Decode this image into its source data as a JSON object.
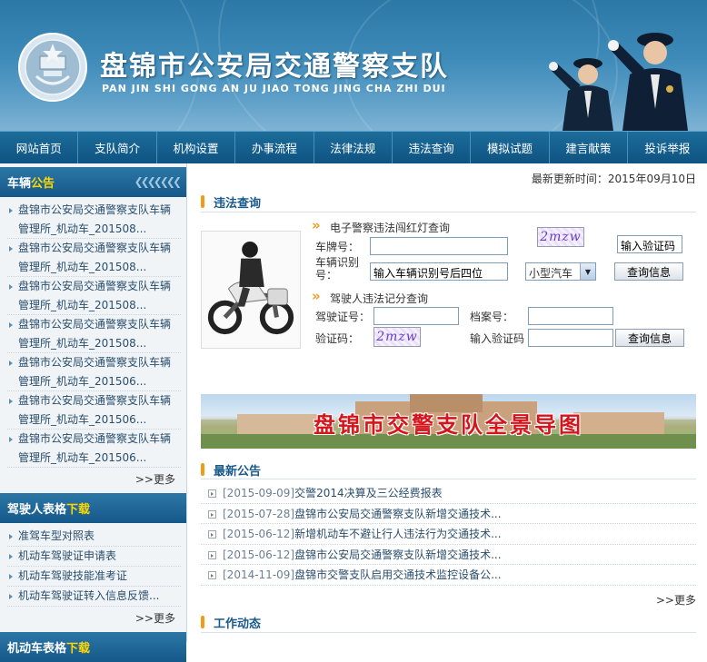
{
  "header": {
    "title": "盘锦市公安局交通警察支队",
    "subtitle": "PAN JIN SHI GONG AN JU JIAO TONG JING CHA ZHI DUI"
  },
  "nav": [
    "网站首页",
    "支队简介",
    "机构设置",
    "办事流程",
    "法律法规",
    "违法查询",
    "模拟试题",
    "建言献策",
    "投诉举报"
  ],
  "sidebar": {
    "vehicle_notice": {
      "title_a": "车辆",
      "title_b": "公告",
      "items": [
        "盘锦市公安局交通警察支队车辆管理所_机动车_201508...",
        "盘锦市公安局交通警察支队车辆管理所_机动车_201508...",
        "盘锦市公安局交通警察支队车辆管理所_机动车_201508...",
        "盘锦市公安局交通警察支队车辆管理所_机动车_201508...",
        "盘锦市公安局交通警察支队车辆管理所_机动车_201506...",
        "盘锦市公安局交通警察支队车辆管理所_机动车_201506...",
        "盘锦市公安局交通警察支队车辆管理所_机动车_201506..."
      ],
      "more": ">>更多"
    },
    "driver_forms": {
      "title_a": "驾驶人表格",
      "title_b": "下载",
      "items": [
        "准驾车型对照表",
        "机动车驾驶证申请表",
        "机动车驾驶技能准考证",
        "机动车驾驶证转入信息反馈..."
      ],
      "more": ">>更多"
    },
    "vehicle_forms": {
      "title_a": "机动车表格",
      "title_b": "下载"
    }
  },
  "main": {
    "update_time": "最新更新时间：2015年09月10日",
    "violation": {
      "title": "违法查询",
      "camera_head": "电子警察违法闯红灯查询",
      "plate_label": "车牌号：",
      "vin_label": "车辆识别号：",
      "vin_value": "输入车辆识别号后四位",
      "car_type": "小型汽车",
      "captcha_text": "2mzw",
      "captcha_value": "输入验证码",
      "query_btn": "查询信息",
      "points_head": "驾驶人违法记分查询",
      "license_label": "驾驶证号：",
      "file_label": "档案号：",
      "code_label": "验证码：",
      "code_text": "2mzw",
      "code_input_label": "输入验证码",
      "query_btn2": "查询信息"
    },
    "banner_text": "盘锦市交警支队全景导图",
    "news": {
      "title": "最新公告",
      "items": [
        {
          "date": "[2015-09-09]",
          "text": "交警2014决算及三公经费报表"
        },
        {
          "date": "[2015-07-28]",
          "text": "盘锦市公安局交通警察支队新增交通技术..."
        },
        {
          "date": "[2015-06-12]",
          "text": "新增机动车不避让行人违法行为交通技术..."
        },
        {
          "date": "[2015-06-12]",
          "text": "盘锦市公安局交通警察支队新增交通技术..."
        },
        {
          "date": "[2014-11-09]",
          "text": "盘锦市交警支队启用交通技术监控设备公..."
        }
      ],
      "more": ">>更多"
    },
    "work_title": "工作动态"
  }
}
